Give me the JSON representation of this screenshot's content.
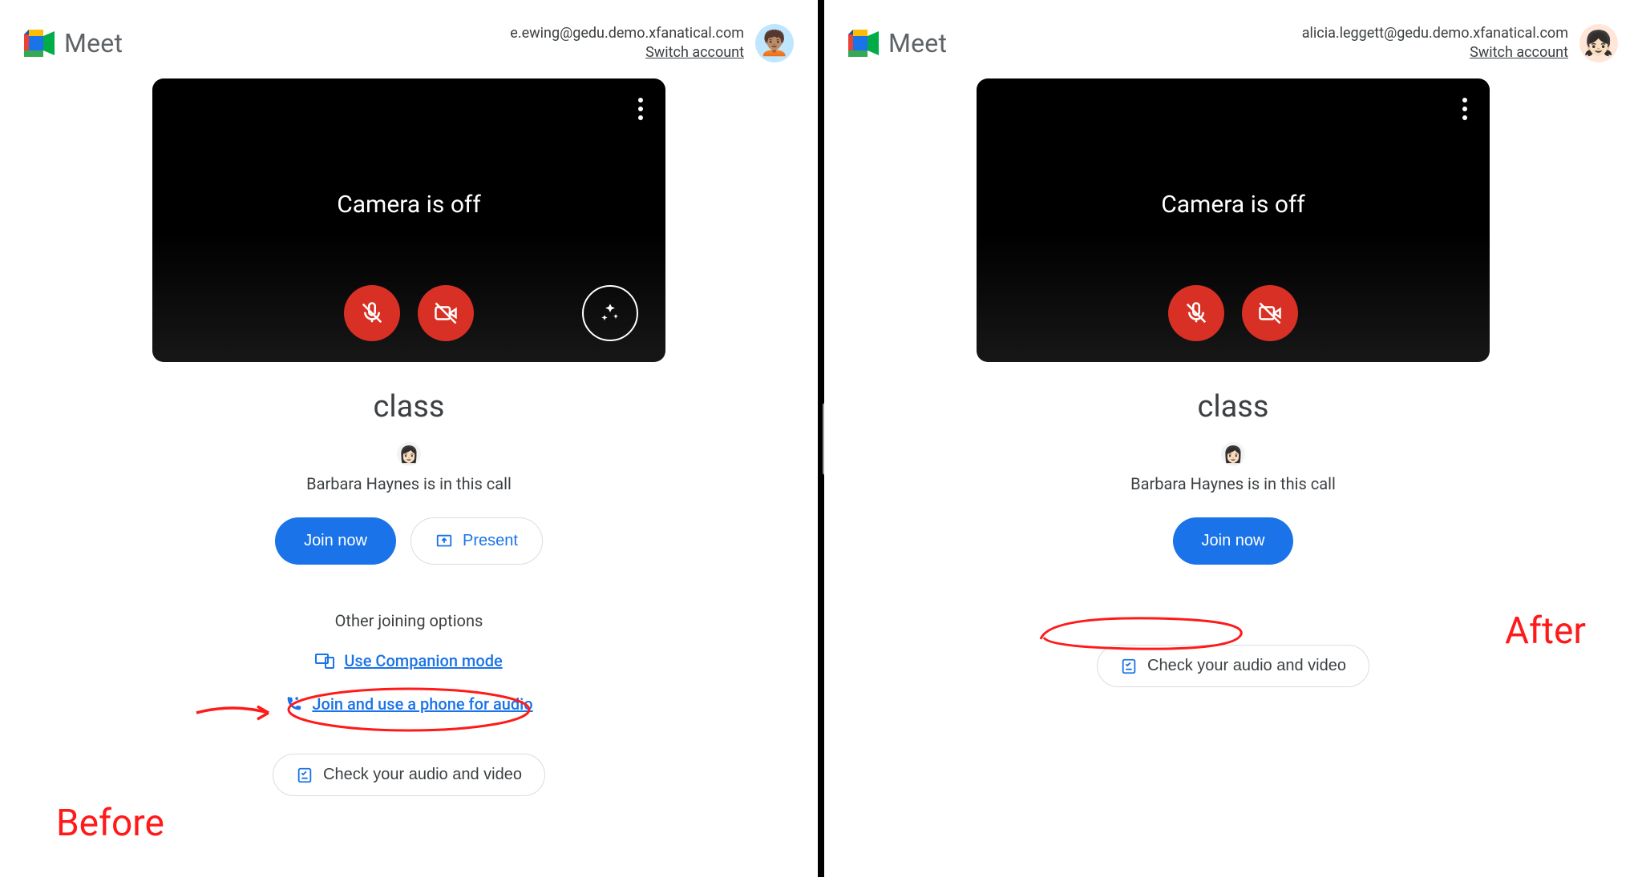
{
  "brand": {
    "name": "Meet"
  },
  "left": {
    "account_email": "e.ewing@gedu.demo.xfanatical.com",
    "switch_label": "Switch account",
    "preview_status": "Camera is off",
    "meeting_title": "class",
    "participant_line": "Barbara Haynes is in this call",
    "join_label": "Join now",
    "present_label": "Present",
    "other_heading": "Other joining options",
    "companion_label": "Use Companion mode",
    "phone_label": "Join and use a phone for audio",
    "check_av_label": "Check your audio and video",
    "anno_label": "Before"
  },
  "right": {
    "account_email": "alicia.leggett@gedu.demo.xfanatical.com",
    "switch_label": "Switch account",
    "preview_status": "Camera is off",
    "meeting_title": "class",
    "participant_line": "Barbara Haynes is in this call",
    "join_label": "Join now",
    "check_av_label": "Check your audio and video",
    "anno_label": "After"
  }
}
